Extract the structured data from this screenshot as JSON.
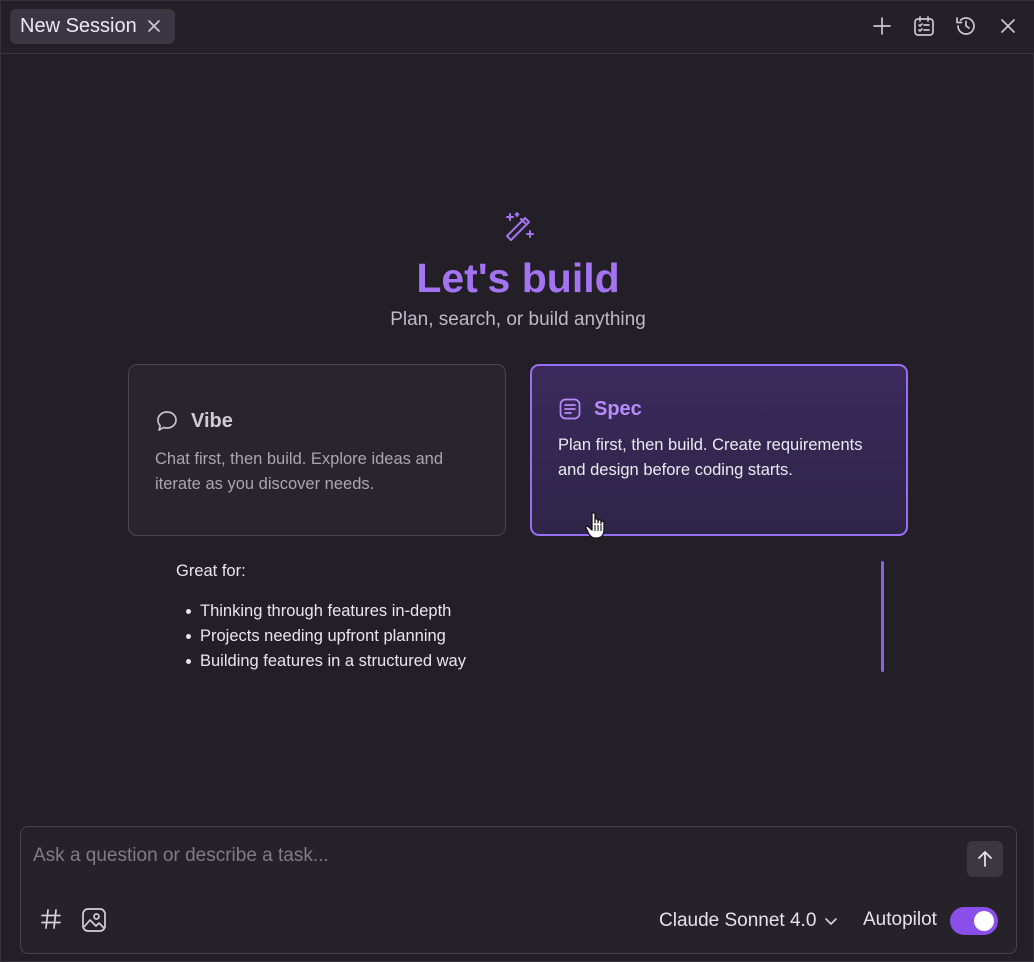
{
  "tab": {
    "label": "New Session"
  },
  "toolbar": {
    "icons": [
      "plus-icon",
      "task-list-icon",
      "history-icon",
      "close-icon"
    ]
  },
  "hero": {
    "icon": "magic-wand-icon",
    "title": "Let's build",
    "subtitle": "Plan, search, or build anything"
  },
  "modes": [
    {
      "icon": "chat-bubble-icon",
      "title": "Vibe",
      "description": "Chat first, then build. Explore ideas and iterate as you discover needs.",
      "selected": false
    },
    {
      "icon": "document-list-icon",
      "title": "Spec",
      "description": "Plan first, then build. Create requirements and design before coding starts.",
      "selected": true
    }
  ],
  "details": {
    "heading": "Great for:",
    "items": [
      "Thinking through features in-depth",
      "Projects needing upfront planning",
      "Building features in a structured way"
    ]
  },
  "composer": {
    "placeholder": "Ask a question or describe a task...",
    "model": "Claude Sonnet 4.0",
    "autopilot_label": "Autopilot",
    "autopilot_on": true
  },
  "colors": {
    "accent": "#a473f2",
    "toggle": "#8a4fe8",
    "background": "#221f27"
  }
}
